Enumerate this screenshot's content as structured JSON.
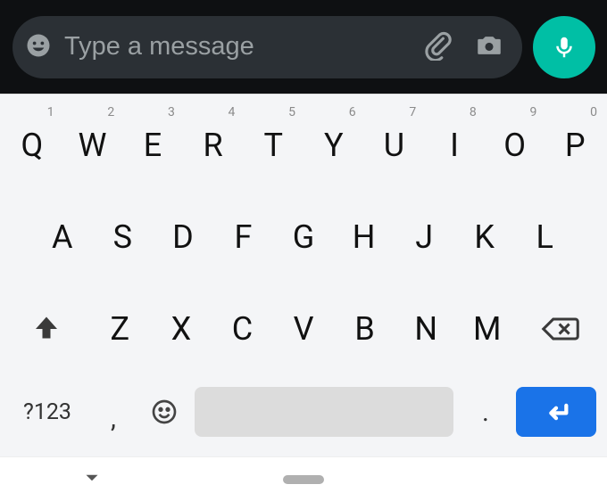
{
  "composer": {
    "placeholder": "Type a message",
    "value": ""
  },
  "keyboard": {
    "row1": [
      {
        "letter": "Q",
        "hint": "1"
      },
      {
        "letter": "W",
        "hint": "2"
      },
      {
        "letter": "E",
        "hint": "3"
      },
      {
        "letter": "R",
        "hint": "4"
      },
      {
        "letter": "T",
        "hint": "5"
      },
      {
        "letter": "Y",
        "hint": "6"
      },
      {
        "letter": "U",
        "hint": "7"
      },
      {
        "letter": "I",
        "hint": "8"
      },
      {
        "letter": "O",
        "hint": "9"
      },
      {
        "letter": "P",
        "hint": "0"
      }
    ],
    "row2": [
      "A",
      "S",
      "D",
      "F",
      "G",
      "H",
      "J",
      "K",
      "L"
    ],
    "row3": [
      "Z",
      "X",
      "C",
      "V",
      "B",
      "N",
      "M"
    ],
    "symbols_label": "?123",
    "comma": ",",
    "period": "."
  }
}
